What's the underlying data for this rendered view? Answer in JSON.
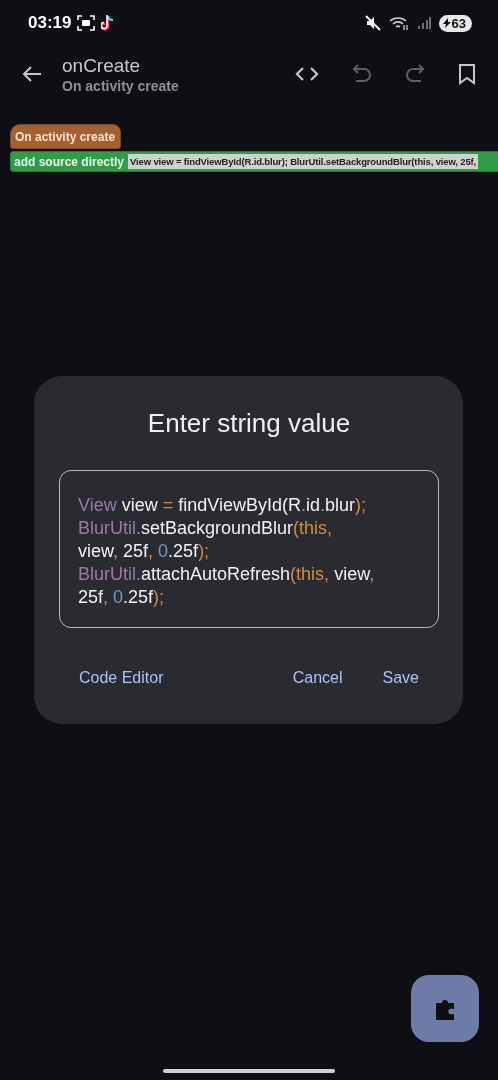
{
  "status_bar": {
    "time": "03:19",
    "battery": "63"
  },
  "toolbar": {
    "title": "onCreate",
    "subtitle": "On activity create"
  },
  "blocks": [
    {
      "kind": "event",
      "label": "On activity create"
    },
    {
      "kind": "source",
      "label": "add source directly",
      "value": "View view = findViewById(R.id.blur); BlurUtil.setBackgroundBlur(this, view, 25f,"
    }
  ],
  "dialog": {
    "title": "Enter string value",
    "code_lines": [
      [
        {
          "text": "View",
          "kind": "type"
        },
        {
          "text": " view ",
          "kind": "plain"
        },
        {
          "text": "=",
          "kind": "op"
        },
        {
          "text": " findViewById(R",
          "kind": "plain"
        },
        {
          "text": ".",
          "kind": "op"
        },
        {
          "text": "id",
          "kind": "plain"
        },
        {
          "text": ".",
          "kind": "op"
        },
        {
          "text": "blur",
          "kind": "plain"
        },
        {
          "text": ");",
          "kind": "op"
        }
      ],
      [
        {
          "text": "BlurUtil.",
          "kind": "type"
        },
        {
          "text": "setBackgroundBlur",
          "kind": "plain"
        },
        {
          "text": "(this,",
          "kind": "op"
        }
      ],
      [
        {
          "text": "view",
          "kind": "plain"
        },
        {
          "text": ",",
          "kind": "op"
        },
        {
          "text": " 25f",
          "kind": "plain"
        },
        {
          "text": ", ",
          "kind": "op"
        },
        {
          "text": "0",
          "kind": "num"
        },
        {
          "text": ".25f",
          "kind": "plain"
        },
        {
          "text": ");",
          "kind": "op"
        }
      ],
      [
        {
          "text": "BlurUtil.",
          "kind": "type"
        },
        {
          "text": "attachAutoRefresh",
          "kind": "plain"
        },
        {
          "text": "(this,",
          "kind": "op"
        },
        {
          "text": " view",
          "kind": "plain"
        },
        {
          "text": ",",
          "kind": "op"
        }
      ],
      [
        {
          "text": "25f",
          "kind": "plain"
        },
        {
          "text": ", ",
          "kind": "op"
        },
        {
          "text": "0",
          "kind": "num"
        },
        {
          "text": ".25f",
          "kind": "plain"
        },
        {
          "text": ");",
          "kind": "op"
        }
      ]
    ],
    "buttons": [
      {
        "label": "Code Editor",
        "kind": "left"
      },
      {
        "label": "Cancel",
        "kind": "right"
      },
      {
        "label": "Save",
        "kind": "right"
      }
    ]
  }
}
